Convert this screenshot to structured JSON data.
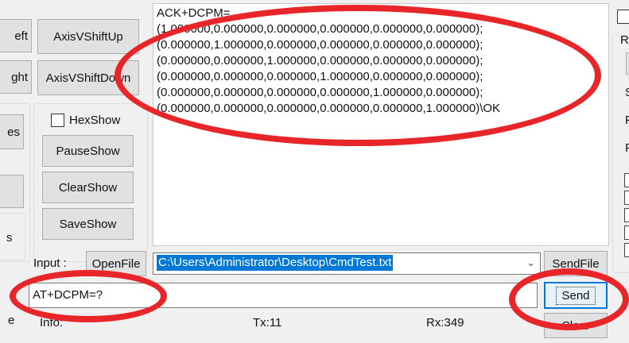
{
  "left_panel": {
    "axis_left_label": "eft",
    "axis_right_label": "ght",
    "side_button_label": "es",
    "side_label": "s",
    "side_bottom_label": "e"
  },
  "axis_buttons": {
    "shift_up": "AxisVShiftUp",
    "shift_down": "AxisVShiftDown"
  },
  "display": {
    "hexshow_label": "HexShow",
    "hexshow_checked": false,
    "pause": "PauseShow",
    "clear": "ClearShow",
    "save": "SaveShow"
  },
  "log_text": "ACK+DCPM=\n(1.000000,0.000000,0.000000,0.000000,0.000000,0.000000);\n(0.000000,1.000000,0.000000,0.000000,0.000000,0.000000);\n(0.000000,0.000000,1.000000,0.000000,0.000000,0.000000);\n(0.000000,0.000000,0.000000,1.000000,0.000000,0.000000);\n(0.000000,0.000000,0.000000,0.000000,1.000000,0.000000);\n(0.000000,0.000000,0.000000,0.000000,0.000000,1.000000)\\OK",
  "input_row": {
    "label": "Input :",
    "open_file": "OpenFile",
    "file_path": "C:\\Users\\Administrator\\Desktop\\CmdTest.txt",
    "send_file": "SendFile"
  },
  "command": {
    "value": "AT+DCPM=?",
    "send": "Send"
  },
  "status_bar": {
    "info": "Info:",
    "tx": "Tx:11",
    "rx": "Rx:349",
    "clear": "Clear"
  },
  "right_panel": {
    "group_letter": "R",
    "letters": [
      "S",
      "F",
      "F"
    ]
  },
  "highlight_color": "#e8262a"
}
